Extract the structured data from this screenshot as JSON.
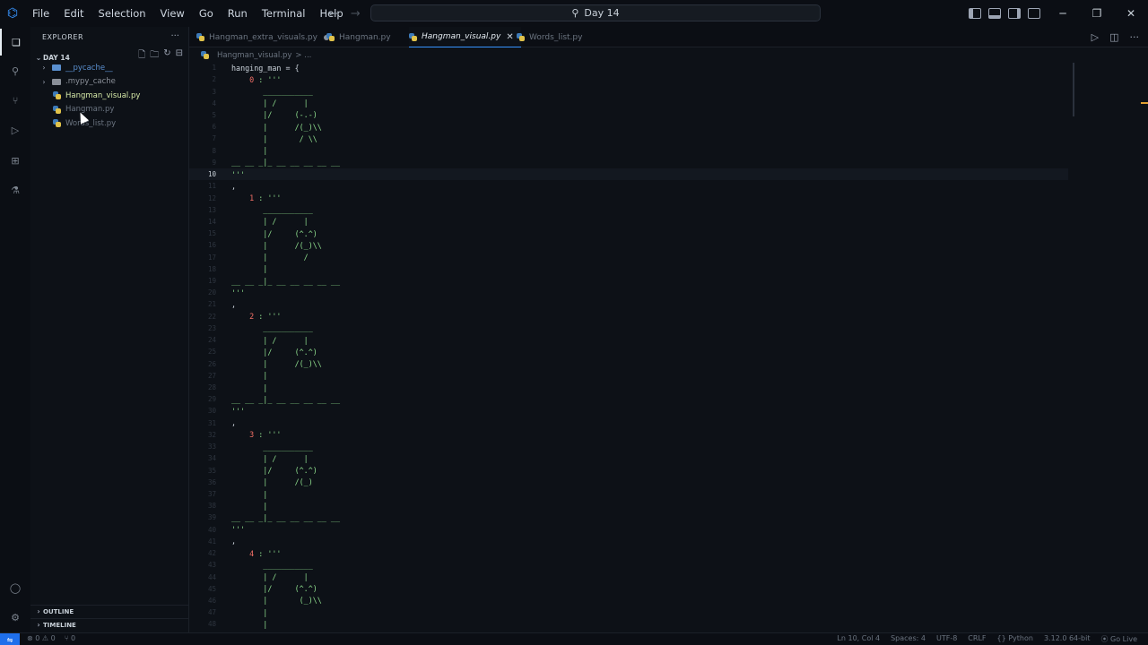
{
  "titlebar": {
    "menu": [
      "File",
      "Edit",
      "Selection",
      "View",
      "Go",
      "Run",
      "Terminal",
      "Help"
    ],
    "search_text": "Day 14"
  },
  "sidebar": {
    "title": "EXPLORER",
    "folder_name": "DAY 14",
    "items": [
      {
        "label": "__pycache__",
        "type": "folder",
        "color": "#5a8fcf"
      },
      {
        "label": ".mypy_cache",
        "type": "folder",
        "color": "#8a8f98"
      },
      {
        "label": "Hangman_visual.py",
        "type": "file",
        "color": "#d6e9a8"
      },
      {
        "label": "Hangman.py",
        "type": "file",
        "color": "#6b7480"
      },
      {
        "label": "Words_list.py",
        "type": "file",
        "color": "#6b7480"
      }
    ],
    "outline": "OUTLINE",
    "timeline": "TIMELINE"
  },
  "tabs": [
    {
      "label": "Hangman_extra_visuals.py",
      "modified": true
    },
    {
      "label": "Hangman.py"
    },
    {
      "label": "Hangman_visual.py",
      "active": true
    },
    {
      "label": "Words_list.py"
    }
  ],
  "breadcrumb": {
    "file": "Hangman_visual.py",
    "rest": "> ..."
  },
  "editor": {
    "current_line": 10,
    "lines": [
      {
        "n": "1",
        "text": "hanging_man = {"
      },
      {
        "n": "2",
        "key": "0",
        "text": "    0 : '''"
      },
      {
        "n": "3",
        "text": "       ___________"
      },
      {
        "n": "4",
        "text": "       | /      |"
      },
      {
        "n": "5",
        "text": "       |/     (-.-)"
      },
      {
        "n": "6",
        "text": "       |      /(_)\\\\"
      },
      {
        "n": "7",
        "text": "       |       / \\\\"
      },
      {
        "n": "8",
        "text": "       |"
      },
      {
        "n": "9",
        "text": "__ __ _|_ __ __ __ __ __"
      },
      {
        "n": "10",
        "text": "'''"
      },
      {
        "n": "11",
        "text": ","
      },
      {
        "n": "12",
        "key": "1",
        "text": "    1 : '''"
      },
      {
        "n": "13",
        "text": "       ___________"
      },
      {
        "n": "14",
        "text": "       | /      |"
      },
      {
        "n": "15",
        "text": "       |/     (^.^)"
      },
      {
        "n": "16",
        "text": "       |      /(_)\\\\"
      },
      {
        "n": "17",
        "text": "       |        /"
      },
      {
        "n": "18",
        "text": "       |"
      },
      {
        "n": "19",
        "text": "__ __ _|_ __ __ __ __ __"
      },
      {
        "n": "20",
        "text": "'''"
      },
      {
        "n": "21",
        "text": ","
      },
      {
        "n": "22",
        "key": "2",
        "text": "    2 : '''"
      },
      {
        "n": "23",
        "text": "       ___________"
      },
      {
        "n": "24",
        "text": "       | /      |"
      },
      {
        "n": "25",
        "text": "       |/     (^.^)"
      },
      {
        "n": "26",
        "text": "       |      /(_)\\\\"
      },
      {
        "n": "27",
        "text": "       |"
      },
      {
        "n": "28",
        "text": "       |"
      },
      {
        "n": "29",
        "text": "__ __ _|_ __ __ __ __ __"
      },
      {
        "n": "30",
        "text": "'''"
      },
      {
        "n": "31",
        "text": ","
      },
      {
        "n": "32",
        "key": "3",
        "text": "    3 : '''"
      },
      {
        "n": "33",
        "text": "       ___________"
      },
      {
        "n": "34",
        "text": "       | /      |"
      },
      {
        "n": "35",
        "text": "       |/     (^.^)"
      },
      {
        "n": "36",
        "text": "       |      /(_)"
      },
      {
        "n": "37",
        "text": "       |"
      },
      {
        "n": "38",
        "text": "       |"
      },
      {
        "n": "39",
        "text": "__ __ _|_ __ __ __ __ __"
      },
      {
        "n": "40",
        "text": "'''"
      },
      {
        "n": "41",
        "text": ","
      },
      {
        "n": "42",
        "key": "4",
        "text": "    4 : '''"
      },
      {
        "n": "43",
        "text": "       ___________"
      },
      {
        "n": "44",
        "text": "       | /      |"
      },
      {
        "n": "45",
        "text": "       |/     (^.^)"
      },
      {
        "n": "46",
        "text": "       |       (_)\\\\"
      },
      {
        "n": "47",
        "text": "       |"
      },
      {
        "n": "48",
        "text": "       |"
      }
    ]
  },
  "statusbar": {
    "problems": "⊗ 0 ⚠ 0",
    "ports": "⑂ 0",
    "position": "Ln 10, Col 4",
    "spaces": "Spaces: 4",
    "encoding": "UTF-8",
    "eol": "CRLF",
    "language": "Python",
    "interpreter": "3.12.0 64-bit",
    "golive": "Go Live"
  }
}
